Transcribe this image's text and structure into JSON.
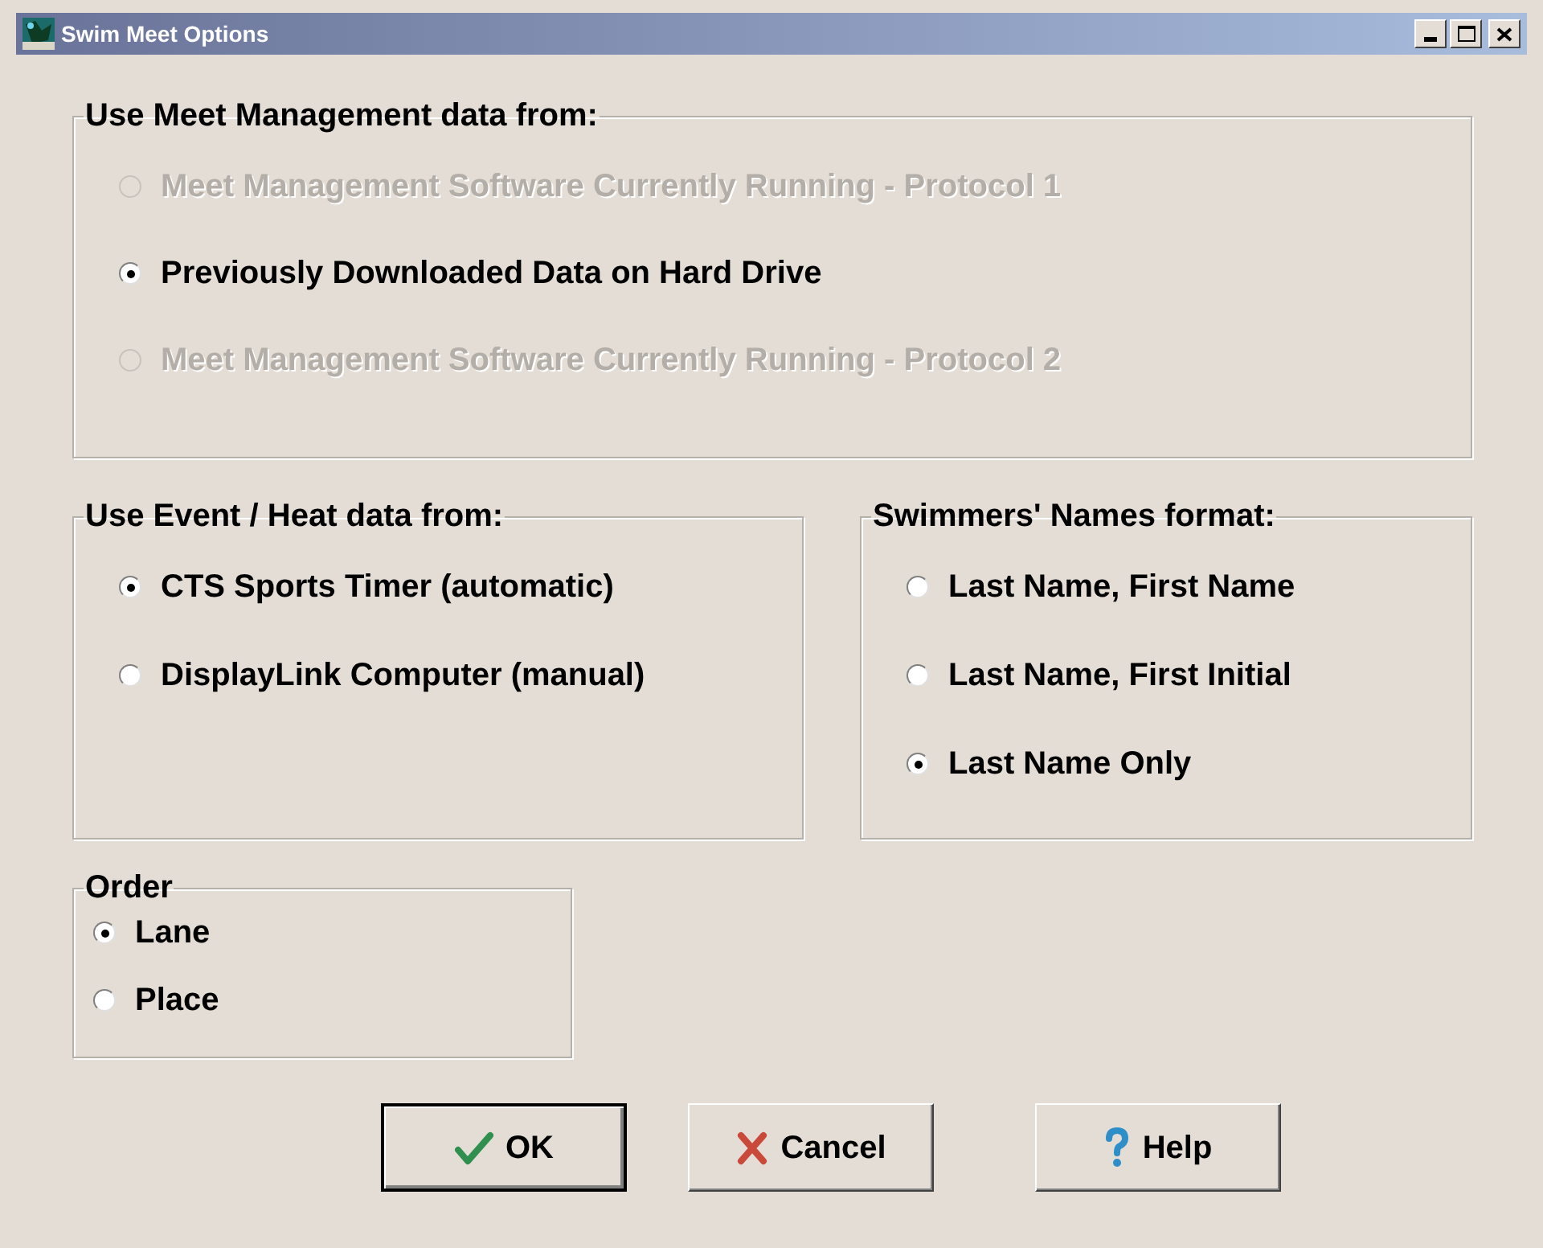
{
  "window": {
    "title": "Swim Meet Options"
  },
  "groups": [
    {
      "title": "Use Meet Management data from:",
      "options": [
        {
          "label": "Meet Management Software Currently Running - Protocol 1",
          "selected": false,
          "disabled": true
        },
        {
          "label": "Previously Downloaded Data on Hard Drive",
          "selected": true,
          "disabled": false
        },
        {
          "label": "Meet Management Software Currently Running - Protocol 2",
          "selected": false,
          "disabled": true
        }
      ]
    },
    {
      "title": "Use Event / Heat data from:",
      "options": [
        {
          "label": "CTS Sports Timer (automatic)",
          "selected": true,
          "disabled": false
        },
        {
          "label": "DisplayLink Computer (manual)",
          "selected": false,
          "disabled": false
        }
      ]
    },
    {
      "title": "Swimmers' Names format:",
      "options": [
        {
          "label": "Last Name, First Name",
          "selected": false,
          "disabled": false
        },
        {
          "label": "Last Name, First Initial",
          "selected": false,
          "disabled": false
        },
        {
          "label": "Last Name Only",
          "selected": true,
          "disabled": false
        }
      ]
    },
    {
      "title": "Order",
      "options": [
        {
          "label": "Lane",
          "selected": true,
          "disabled": false
        },
        {
          "label": "Place",
          "selected": false,
          "disabled": false
        }
      ]
    }
  ],
  "buttons": [
    {
      "label": "OK",
      "kind": "ok",
      "default": true
    },
    {
      "label": "Cancel",
      "kind": "cancel",
      "default": false
    },
    {
      "label": "Help",
      "kind": "help",
      "default": false
    }
  ]
}
